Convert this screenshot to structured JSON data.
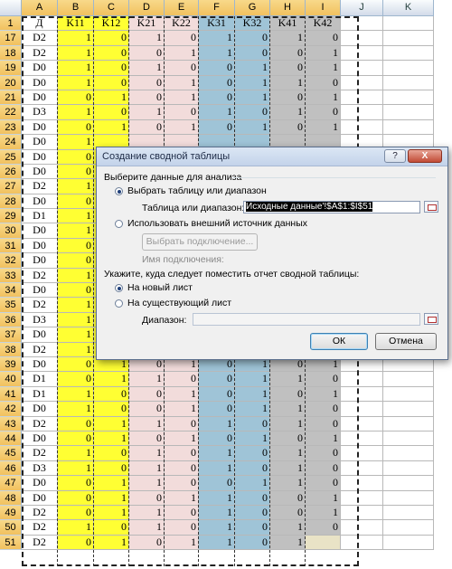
{
  "columns": [
    "A",
    "B",
    "C",
    "D",
    "E",
    "F",
    "G",
    "H",
    "I",
    "J",
    "K"
  ],
  "header_row": {
    "row": "1",
    "cells": [
      "Д",
      "K11",
      "K12",
      "K21",
      "K22",
      "K31",
      "K32",
      "K41",
      "K42",
      "",
      ""
    ]
  },
  "rows": [
    {
      "r": "17",
      "cells": [
        "D2",
        "1",
        "0",
        "1",
        "0",
        "1",
        "0",
        "1",
        "0"
      ]
    },
    {
      "r": "18",
      "cells": [
        "D2",
        "1",
        "0",
        "0",
        "1",
        "1",
        "0",
        "0",
        "1"
      ]
    },
    {
      "r": "19",
      "cells": [
        "D0",
        "1",
        "0",
        "1",
        "0",
        "0",
        "1",
        "0",
        "1"
      ]
    },
    {
      "r": "20",
      "cells": [
        "D0",
        "1",
        "0",
        "0",
        "1",
        "0",
        "1",
        "1",
        "0"
      ]
    },
    {
      "r": "21",
      "cells": [
        "D0",
        "0",
        "1",
        "0",
        "1",
        "0",
        "1",
        "0",
        "1"
      ]
    },
    {
      "r": "22",
      "cells": [
        "D3",
        "1",
        "0",
        "1",
        "0",
        "1",
        "0",
        "1",
        "0"
      ]
    },
    {
      "r": "23",
      "cells": [
        "D0",
        "0",
        "1",
        "0",
        "1",
        "0",
        "1",
        "0",
        "1"
      ]
    },
    {
      "r": "24",
      "cells": [
        "D0",
        "1",
        "",
        "",
        "",
        "",
        "",
        "",
        ""
      ]
    },
    {
      "r": "25",
      "cells": [
        "D0",
        "0",
        "",
        "",
        "",
        "",
        "",
        "",
        ""
      ]
    },
    {
      "r": "26",
      "cells": [
        "D0",
        "0",
        "",
        "",
        "",
        "",
        "",
        "",
        ""
      ]
    },
    {
      "r": "27",
      "cells": [
        "D2",
        "1",
        "",
        "",
        "",
        "",
        "",
        "",
        ""
      ]
    },
    {
      "r": "28",
      "cells": [
        "D0",
        "0",
        "",
        "",
        "",
        "",
        "",
        "",
        ""
      ]
    },
    {
      "r": "29",
      "cells": [
        "D1",
        "1",
        "",
        "",
        "",
        "",
        "",
        "",
        ""
      ]
    },
    {
      "r": "30",
      "cells": [
        "D0",
        "1",
        "",
        "",
        "",
        "",
        "",
        "",
        ""
      ]
    },
    {
      "r": "31",
      "cells": [
        "D0",
        "0",
        "",
        "",
        "",
        "",
        "",
        "",
        ""
      ]
    },
    {
      "r": "32",
      "cells": [
        "D0",
        "0",
        "",
        "",
        "",
        "",
        "",
        "",
        ""
      ]
    },
    {
      "r": "33",
      "cells": [
        "D2",
        "1",
        "",
        "",
        "",
        "",
        "",
        "",
        ""
      ]
    },
    {
      "r": "34",
      "cells": [
        "D0",
        "0",
        "",
        "",
        "",
        "",
        "",
        "",
        ""
      ]
    },
    {
      "r": "35",
      "cells": [
        "D2",
        "1",
        "",
        "",
        "",
        "",
        "",
        "",
        ""
      ]
    },
    {
      "r": "36",
      "cells": [
        "D3",
        "1",
        "",
        "",
        "",
        "",
        "",
        "",
        ""
      ]
    },
    {
      "r": "37",
      "cells": [
        "D0",
        "1",
        "",
        "",
        "",
        "",
        "",
        "",
        ""
      ]
    },
    {
      "r": "38",
      "cells": [
        "D2",
        "1",
        "",
        "",
        "",
        "",
        "",
        "",
        ""
      ]
    },
    {
      "r": "39",
      "cells": [
        "D0",
        "0",
        "1",
        "0",
        "1",
        "0",
        "1",
        "0",
        "1"
      ]
    },
    {
      "r": "40",
      "cells": [
        "D1",
        "0",
        "1",
        "1",
        "0",
        "0",
        "1",
        "1",
        "0"
      ]
    },
    {
      "r": "41",
      "cells": [
        "D1",
        "1",
        "0",
        "0",
        "1",
        "0",
        "1",
        "0",
        "1"
      ]
    },
    {
      "r": "42",
      "cells": [
        "D0",
        "1",
        "0",
        "0",
        "1",
        "0",
        "1",
        "1",
        "0"
      ]
    },
    {
      "r": "43",
      "cells": [
        "D2",
        "0",
        "1",
        "1",
        "0",
        "1",
        "0",
        "1",
        "0"
      ]
    },
    {
      "r": "44",
      "cells": [
        "D0",
        "0",
        "1",
        "0",
        "1",
        "0",
        "1",
        "0",
        "1"
      ]
    },
    {
      "r": "45",
      "cells": [
        "D2",
        "1",
        "0",
        "1",
        "0",
        "1",
        "0",
        "1",
        "0"
      ]
    },
    {
      "r": "46",
      "cells": [
        "D3",
        "1",
        "0",
        "1",
        "0",
        "1",
        "0",
        "1",
        "0"
      ]
    },
    {
      "r": "47",
      "cells": [
        "D0",
        "0",
        "1",
        "1",
        "0",
        "0",
        "1",
        "1",
        "0"
      ]
    },
    {
      "r": "48",
      "cells": [
        "D0",
        "0",
        "1",
        "0",
        "1",
        "1",
        "0",
        "0",
        "1"
      ]
    },
    {
      "r": "49",
      "cells": [
        "D2",
        "0",
        "1",
        "1",
        "0",
        "1",
        "0",
        "0",
        "1"
      ]
    },
    {
      "r": "50",
      "cells": [
        "D2",
        "1",
        "0",
        "1",
        "0",
        "1",
        "0",
        "1",
        "0"
      ]
    },
    {
      "r": "51",
      "cells": [
        "D2",
        "0",
        "1",
        "0",
        "1",
        "1",
        "0",
        "1",
        ""
      ]
    }
  ],
  "dialog": {
    "title": "Создание сводной таблицы",
    "help_label": "?",
    "close_label": "X",
    "section1": "Выберите данные для анализа",
    "radio_table": "Выбрать таблицу или диапазон",
    "range_label": "Таблица или диапазон:",
    "range_value": "Исходные данные'!$A$1:$I$51",
    "radio_external": "Использовать внешний источник данных",
    "choose_connection": "Выбрать подключение...",
    "connection_name": "Имя подключения:",
    "section2": "Укажите, куда следует поместить отчет сводной таблицы:",
    "radio_new_sheet": "На новый лист",
    "radio_existing_sheet": "На существующий лист",
    "location_label": "Диапазон:",
    "location_value": "",
    "ok": "ОК",
    "cancel": "Отмена"
  }
}
